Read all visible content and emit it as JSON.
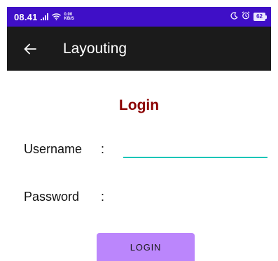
{
  "status_bar": {
    "time": "08.41",
    "net_speed_value": "0.00",
    "net_speed_unit": "KB/S",
    "battery_level": "62",
    "background_color": "#3f0fc7"
  },
  "app_bar": {
    "back_icon": "arrow-left-icon",
    "title": "Layouting",
    "background_color": "#1b1b1b"
  },
  "form": {
    "title": "Login",
    "title_color": "#8b0000",
    "username_label": "Username",
    "username_colon": ":",
    "username_value": "",
    "username_focus_color": "#19c5b8",
    "password_label": "Password",
    "password_colon": ":",
    "password_value": "",
    "login_button_label": "LOGIN",
    "login_button_color": "#bb86fc"
  }
}
